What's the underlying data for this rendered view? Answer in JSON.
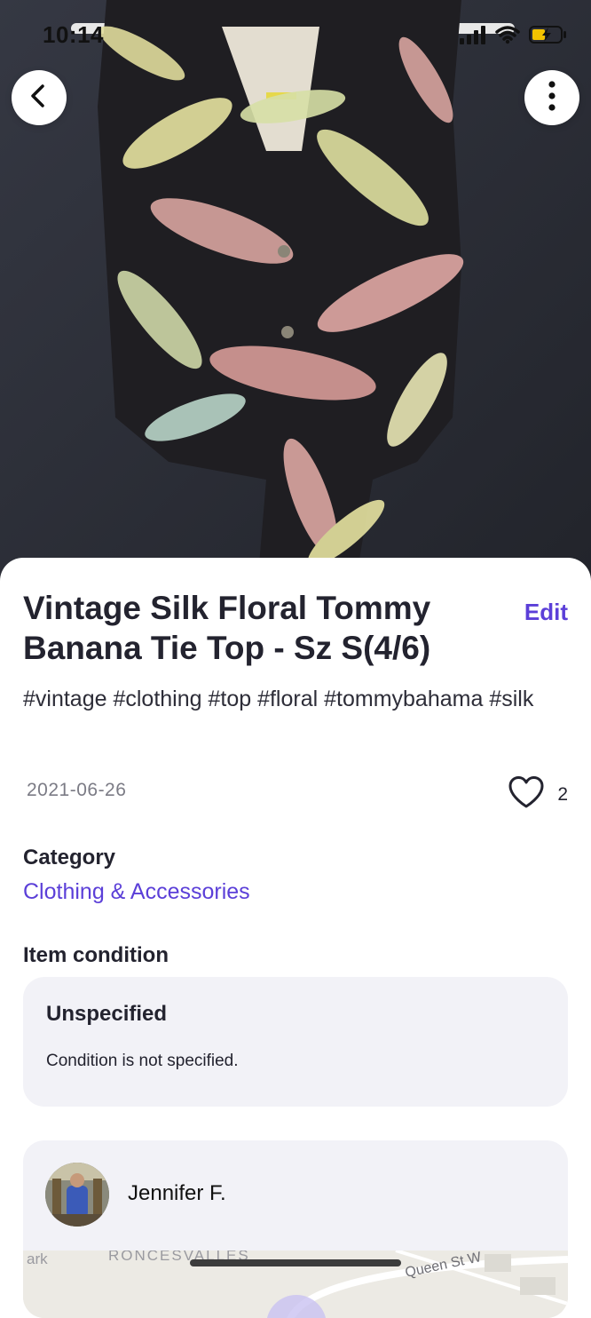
{
  "status_bar": {
    "time": "10:14"
  },
  "nav": {
    "back_icon": "chevron-left-icon",
    "more_icon": "vertical-dots-icon"
  },
  "listing": {
    "title": "Vintage Silk Floral Tommy Banana Tie Top - Sz S(4/6)",
    "edit_label": "Edit",
    "tags": "#vintage #clothing #top #floral #tommybahama #silk",
    "date": "2021-06-26",
    "like_count": "2",
    "category_label": "Category",
    "category_value": "Clothing & Accessories",
    "condition_label": "Item condition",
    "condition_title": "Unspecified",
    "condition_desc": "Condition is not specified."
  },
  "seller": {
    "name": "Jennifer F.",
    "map_labels": [
      "ark",
      "RONCESVALLES",
      "Queen St W"
    ]
  },
  "colors": {
    "accent": "#5b3fd8",
    "card_bg": "#f2f2f7",
    "text": "#23232f",
    "muted": "#7b7b85"
  }
}
